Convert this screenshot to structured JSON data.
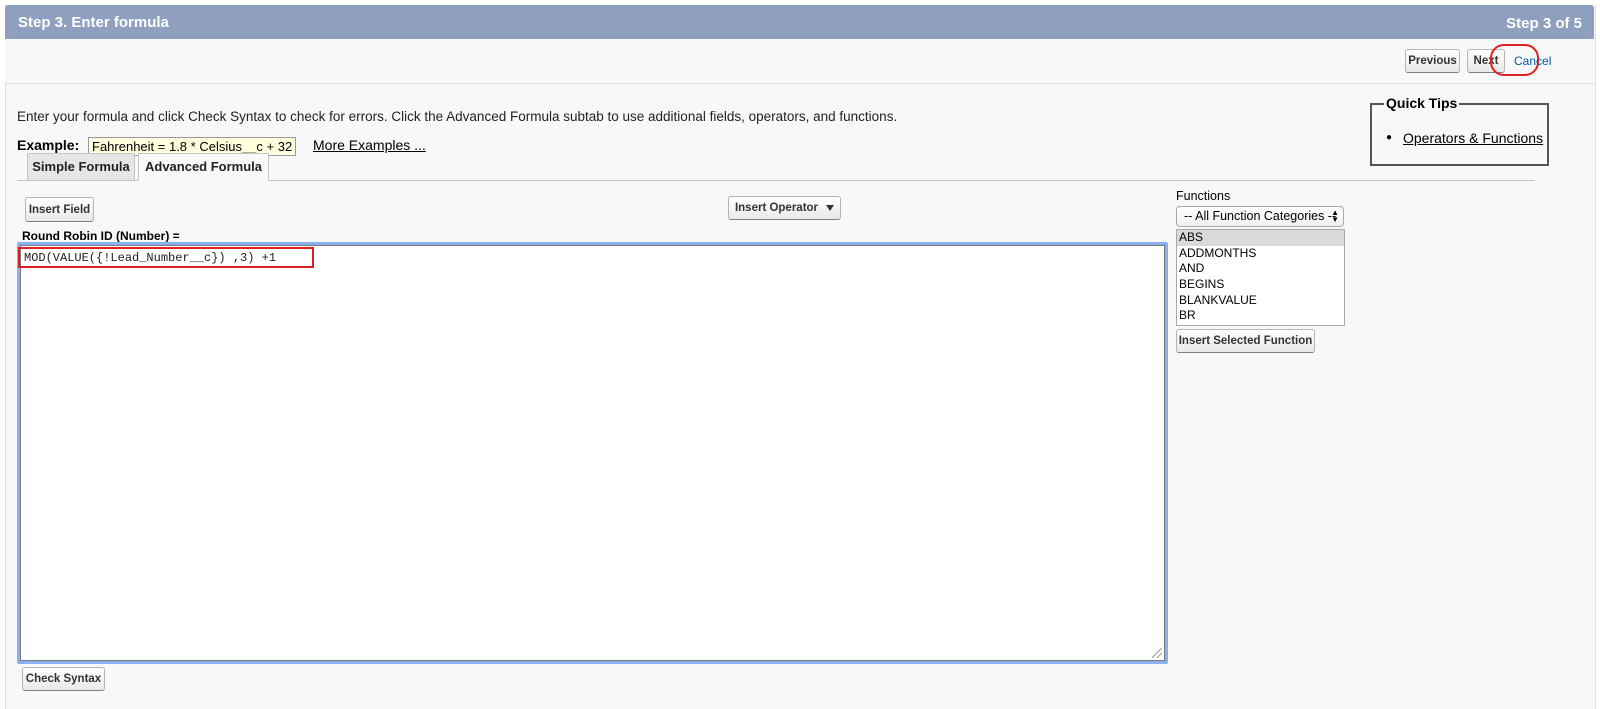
{
  "header": {
    "title": "Step 3. Enter formula",
    "step": "Step 3 of 5"
  },
  "nav": {
    "previous_label": "Previous",
    "next_label": "Next",
    "cancel_label": "Cancel"
  },
  "instructions": "Enter your formula and click Check Syntax to check for errors. Click the Advanced Formula subtab to use additional fields, operators, and functions.",
  "example": {
    "label": "Example:",
    "value": "Fahrenheit = 1.8 * Celsius__c + 32",
    "more_link": "More Examples ..."
  },
  "quick_tips": {
    "title": "Quick Tips",
    "link": "Operators & Functions"
  },
  "tabs": [
    {
      "label": "Simple Formula",
      "active": false
    },
    {
      "label": "Advanced Formula",
      "active": true
    }
  ],
  "toolbar": {
    "insert_field_label": "Insert Field",
    "insert_operator_label": "Insert Operator"
  },
  "field_label": "Round Robin ID (Number) =",
  "formula": "MOD(VALUE({!Lead_Number__c}) ,3) +1",
  "functions": {
    "label": "Functions",
    "category_selected": "-- All Function Categories --",
    "items": [
      "ABS",
      "ADDMONTHS",
      "AND",
      "BEGINS",
      "BLANKVALUE",
      "BR"
    ],
    "selected_item": "ABS",
    "insert_label": "Insert Selected Function"
  },
  "check_syntax_label": "Check Syntax",
  "colors": {
    "header_bg": "#8e9fbf",
    "link": "#015ba7",
    "highlight": "#e02020",
    "focus_ring": "#8ab0f0"
  }
}
